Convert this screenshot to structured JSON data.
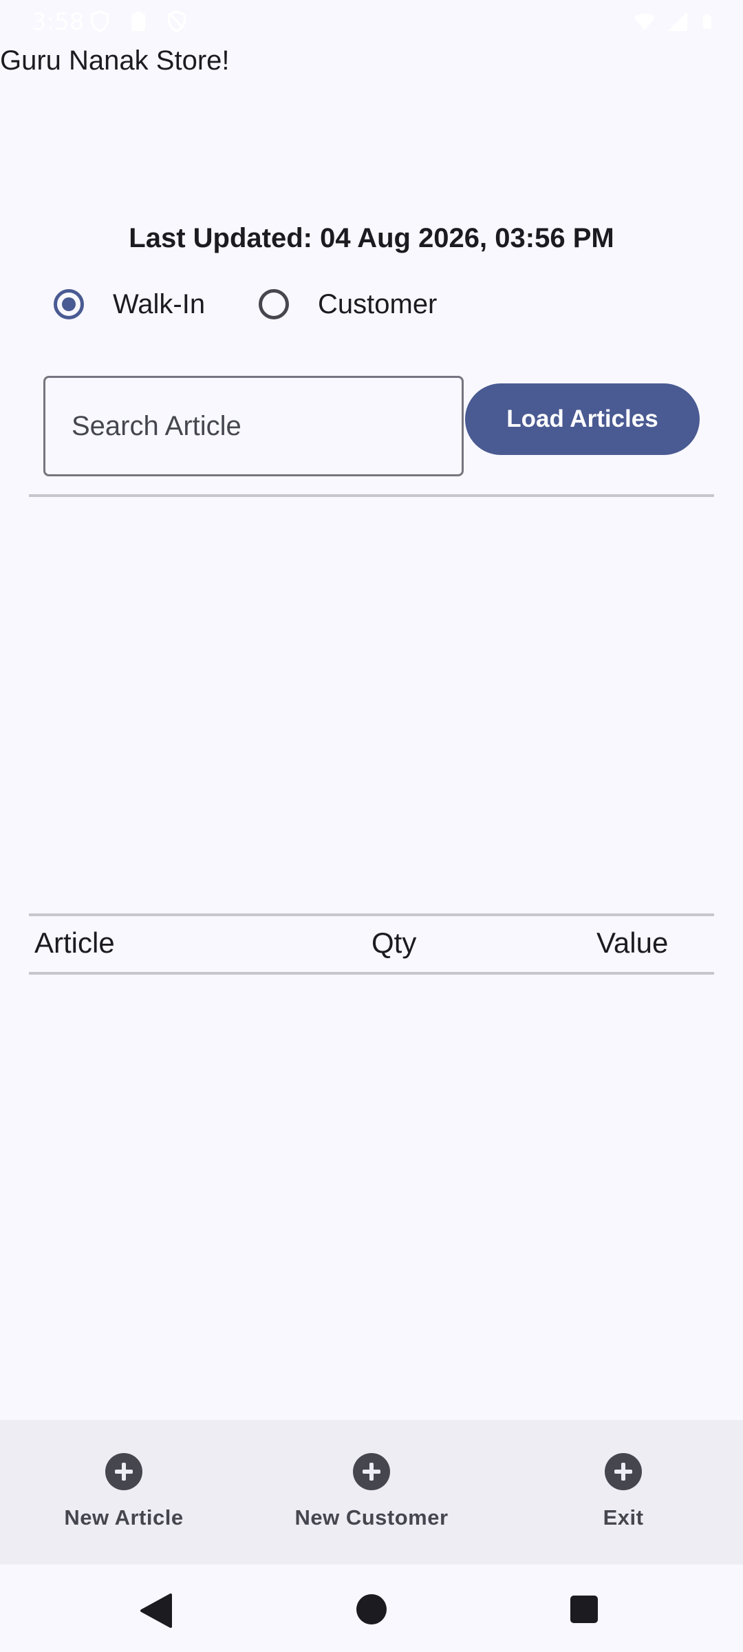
{
  "status_bar": {
    "time": "3:58",
    "left_icons": [
      "shield-icon",
      "clipboard-icon",
      "shield-icon"
    ],
    "right_icons": [
      "wifi-icon",
      "signal-icon",
      "battery-icon"
    ]
  },
  "app": {
    "title": "Guru Nanak Store!"
  },
  "last_updated": "Last Updated: 04 Aug 2026, 03:56 PM",
  "customer_type": {
    "options": [
      {
        "label": "Walk-In",
        "selected": true
      },
      {
        "label": "Customer",
        "selected": false
      }
    ]
  },
  "search": {
    "placeholder": "Search Article",
    "value": ""
  },
  "load_button": {
    "label": "Load Articles"
  },
  "table": {
    "columns": [
      "Article",
      "Qty",
      "Value"
    ],
    "rows": []
  },
  "bottom_nav": {
    "items": [
      {
        "label": "New Article",
        "icon": "add-circle-icon"
      },
      {
        "label": "New Customer",
        "icon": "add-circle-icon"
      },
      {
        "label": "Exit",
        "icon": "add-circle-icon"
      }
    ]
  },
  "system_nav": [
    "back-icon",
    "home-icon",
    "recents-icon"
  ],
  "colors": {
    "background": "#f8f8fe",
    "accent": "#4a5a92",
    "nav_background": "#eeedf4",
    "divider": "#c7c6cc"
  }
}
